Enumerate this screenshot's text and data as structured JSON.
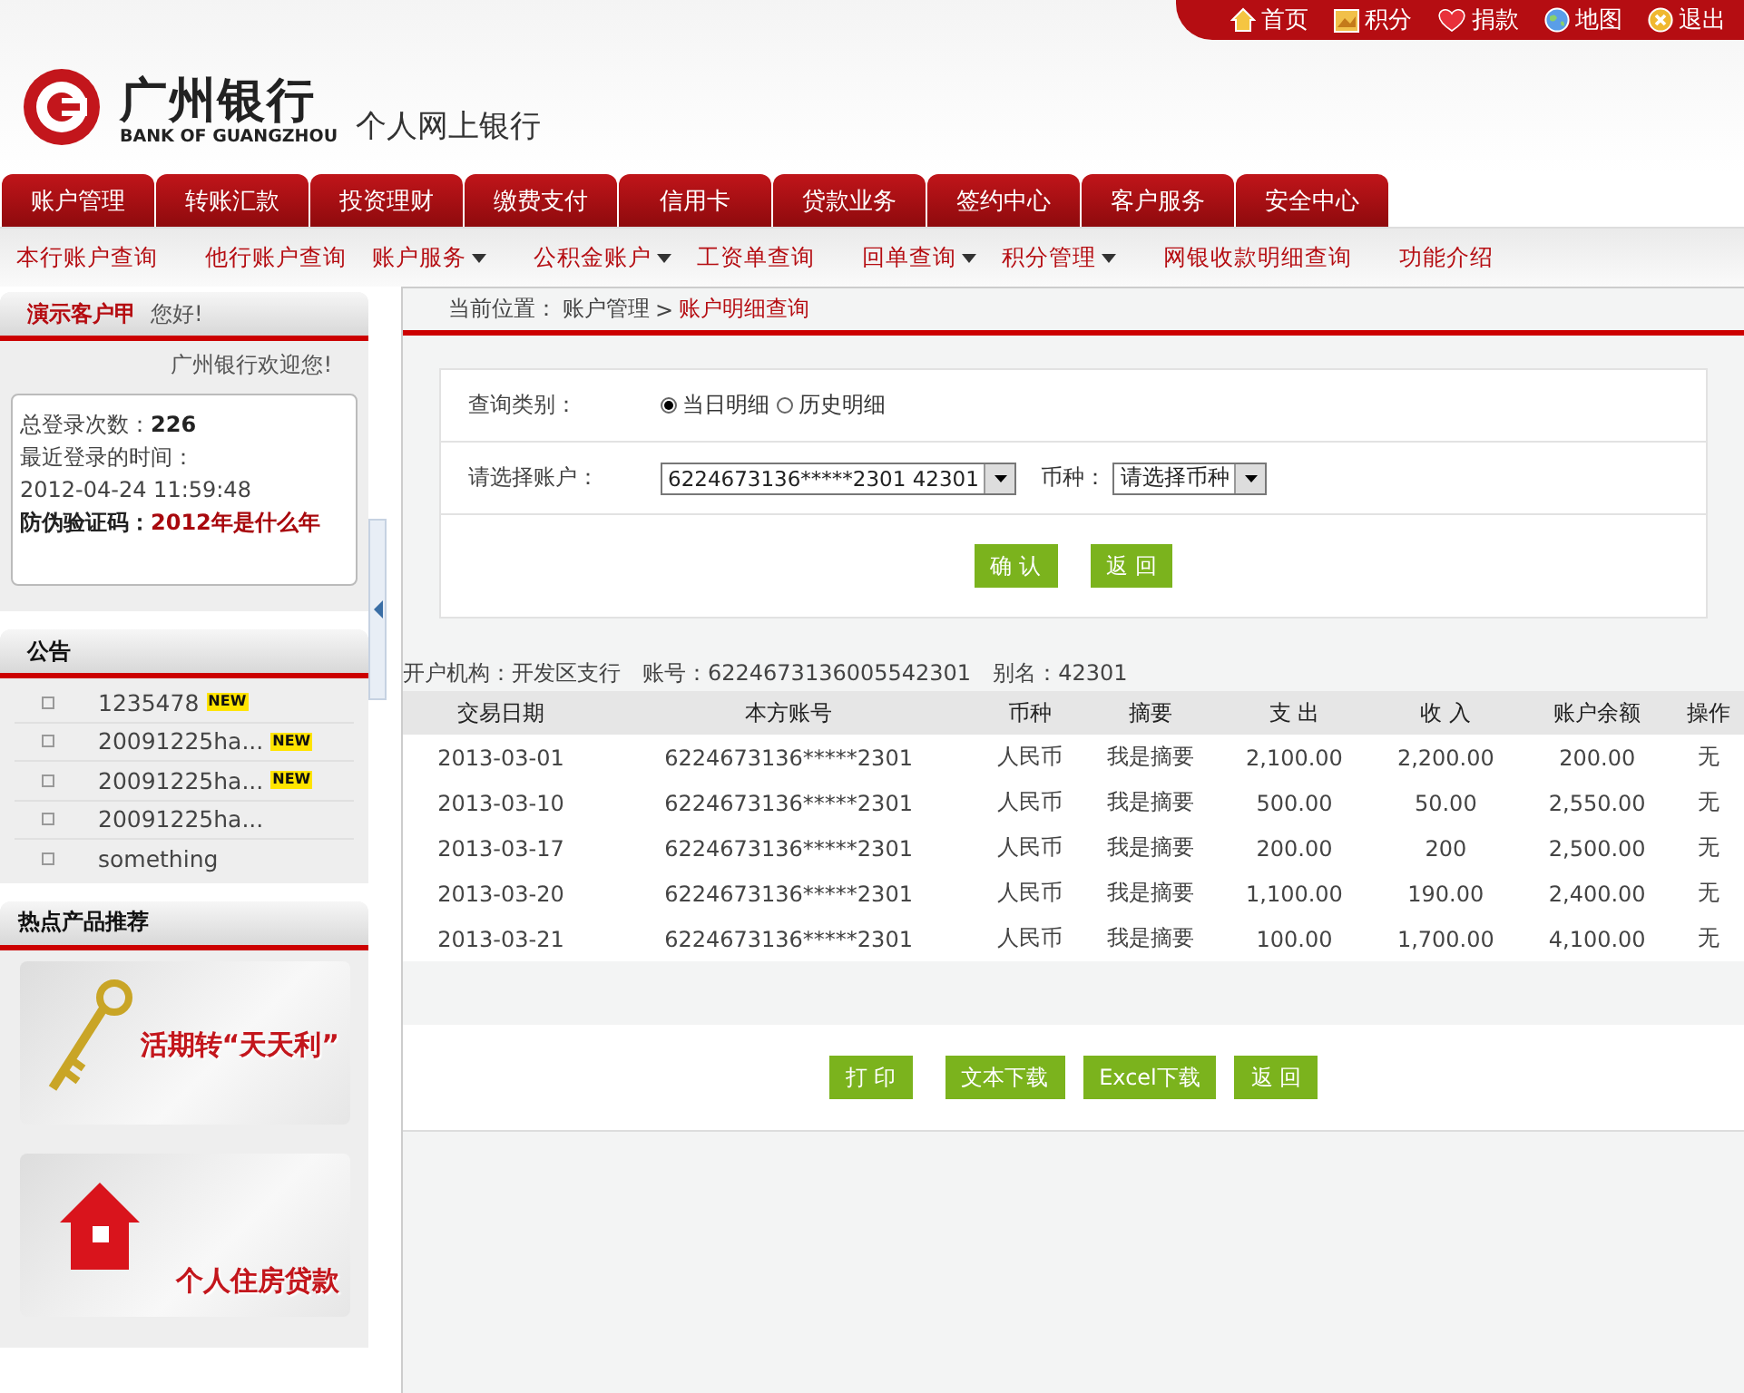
{
  "top_links": [
    {
      "label": "首页",
      "kind": "home"
    },
    {
      "label": "积分",
      "kind": "points"
    },
    {
      "label": "捐款",
      "kind": "heart"
    },
    {
      "label": "地图",
      "kind": "globe"
    },
    {
      "label": "退出",
      "kind": "exit"
    }
  ],
  "logo": {
    "name": "广州银行",
    "english": "BANK OF GUANGZHOU",
    "subtitle": "个人网上银行"
  },
  "main_nav": [
    "账户管理",
    "转账汇款",
    "投资理财",
    "缴费支付",
    "信用卡",
    "贷款业务",
    "签约中心",
    "客户服务",
    "安全中心"
  ],
  "sub_nav": [
    {
      "label": "本行账户查询",
      "dropdown": false
    },
    {
      "label": "他行账户查询",
      "dropdown": false
    },
    {
      "label": "账户服务",
      "dropdown": true
    },
    {
      "label": "公积金账户",
      "dropdown": true
    },
    {
      "label": "工资单查询",
      "dropdown": false
    },
    {
      "label": "回单查询",
      "dropdown": true
    },
    {
      "label": "积分管理",
      "dropdown": true
    },
    {
      "label": "网银收款明细查询",
      "dropdown": false
    },
    {
      "label": "功能介绍",
      "dropdown": false
    }
  ],
  "user_panel": {
    "name": "演示客户甲",
    "greeting": "您好!",
    "welcome": "广州银行欢迎您!",
    "login_count_label": "总登录次数：",
    "login_count": "226",
    "last_login_label": "最近登录的时间：",
    "last_login": "2012-04-24 11:59:48",
    "code_label": "防伪验证码：",
    "code": "2012年是什么年"
  },
  "notices": {
    "title": "公告",
    "items": [
      {
        "text": "1235478",
        "new": true,
        "badge": "NEW"
      },
      {
        "text": "20091225ha...",
        "new": true,
        "badge": "NEW"
      },
      {
        "text": "20091225ha...",
        "new": true,
        "badge": "NEW"
      },
      {
        "text": "20091225ha...",
        "new": false
      },
      {
        "text": "something",
        "new": false
      }
    ]
  },
  "products": {
    "title": "热点产品推荐",
    "banners": [
      {
        "kind": "key",
        "caption": "活期转“天天利”"
      },
      {
        "kind": "house",
        "caption": "个人住房贷款"
      }
    ]
  },
  "breadcrumb": {
    "label": "当前位置：",
    "path": "账户管理",
    "separator": ">",
    "current": "账户明细查询"
  },
  "query_form": {
    "type_label": "查询类别：",
    "options": [
      {
        "label": "当日明细",
        "selected": true
      },
      {
        "label": "历史明细",
        "selected": false
      }
    ],
    "account_label": "请选择账户：",
    "account_value": "6224673136*****2301 42301",
    "currency_label": "币种：",
    "currency_value": "请选择币种",
    "buttons": [
      "确 认",
      "返 回"
    ]
  },
  "account_info": [
    {
      "label": "开户机构：",
      "value": "开发区支行"
    },
    {
      "label": "账号：",
      "value": "6224673136005542301"
    },
    {
      "label": "别名：",
      "value": "42301"
    }
  ],
  "table": {
    "columns": [
      "交易日期",
      "本方账号",
      "币种",
      "摘要",
      "支 出",
      "收 入",
      "账户余额",
      "操作"
    ],
    "rows": [
      [
        "2013-03-01",
        "6224673136*****2301",
        "人民币",
        "我是摘要",
        "2,100.00",
        "2,200.00",
        "200.00",
        "无"
      ],
      [
        "2013-03-10",
        "6224673136*****2301",
        "人民币",
        "我是摘要",
        "500.00",
        "50.00",
        "2,550.00",
        "无"
      ],
      [
        "2013-03-17",
        "6224673136*****2301",
        "人民币",
        "我是摘要",
        "200.00",
        "200",
        "2,500.00",
        "无"
      ],
      [
        "2013-03-20",
        "6224673136*****2301",
        "人民币",
        "我是摘要",
        "1,100.00",
        "190.00",
        "2,400.00",
        "无"
      ],
      [
        "2013-03-21",
        "6224673136*****2301",
        "人民币",
        "我是摘要",
        "100.00",
        "1,700.00",
        "4,100.00",
        "无"
      ]
    ]
  },
  "bottom_buttons": [
    "打 印",
    "文本下载",
    "Excel下载",
    "返 回"
  ]
}
